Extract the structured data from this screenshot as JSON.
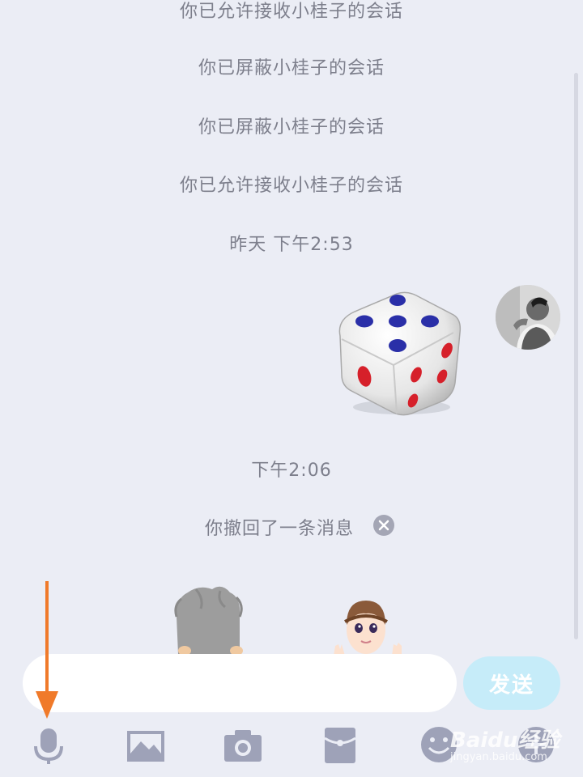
{
  "chat": {
    "system_messages": [
      "你已允许接收小桂子的会话",
      "你已屏蔽小桂子的会话",
      "你已屏蔽小桂子的会话",
      "你已允许接收小桂子的会话"
    ],
    "timestamp_yesterday": "昨天 下午2:53",
    "timestamp_today": "下午2:06",
    "recall_notice": "你撤回了一条消息"
  },
  "composer": {
    "send_label": "发送"
  },
  "toolbar": {
    "icons": [
      "microphone-icon",
      "image-icon",
      "camera-icon",
      "red-packet-icon",
      "emoji-icon",
      "plus-icon"
    ]
  },
  "watermark": {
    "brand": "Baidu经验",
    "url": "jingyan.baidu.com"
  },
  "colors": {
    "background": "#ebedf5",
    "send_button": "#c6ecf9",
    "annotation_arrow": "#f07a2a",
    "icon_gray": "#9ea2b8"
  }
}
